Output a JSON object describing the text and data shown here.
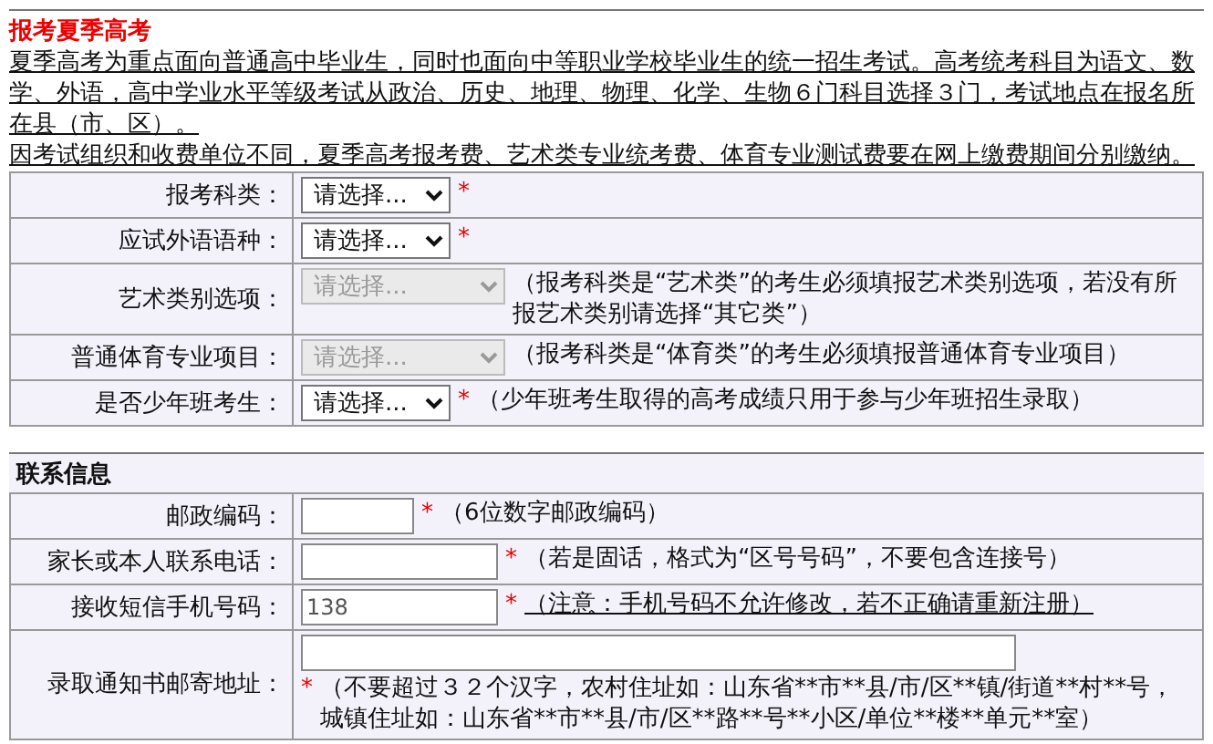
{
  "section_title": "报考夏季高考",
  "intro": [
    {
      "text": "夏季高考为重点面向普通高中毕业生，同时也面向中等职业学校毕业生的统一招生考试。高考统考科目为语文、数学、外语，高中学业水平等级考试从政治、历史、地理、物理、化学、生物６门科目选择３门，考试地点在报名所在县（市、区）。"
    },
    {
      "text": "因考试组织和收费单位不同，夏季高考报考费、艺术类专业统考费、体育专业测试费要在网上缴费期间分别缴纳。"
    }
  ],
  "exam_fields": [
    {
      "label": "报考科类：",
      "kind": "select",
      "value": "请选择...",
      "disabled": false,
      "required_mark": "*"
    },
    {
      "label": "应试外语语种：",
      "kind": "select",
      "value": "请选择...",
      "disabled": false,
      "required_mark": "*"
    },
    {
      "label": "艺术类别选项：",
      "kind": "select",
      "value": "请选择...",
      "disabled": true,
      "note": "（报考科类是“艺术类”的考生必须填报艺术类别选项，若没有所报艺术类别请选择“其它类”）"
    },
    {
      "label": "普通体育专业项目：",
      "kind": "select",
      "value": "请选择...",
      "disabled": true,
      "note": "（报考科类是“体育类”的考生必须填报普通体育专业项目）"
    },
    {
      "label": "是否少年班考生：",
      "kind": "select",
      "value": "请选择...",
      "disabled": false,
      "required_mark": "*",
      "note": "（少年班考生取得的高考成绩只用于参与少年班招生录取）"
    }
  ],
  "contact": {
    "title": "联系信息",
    "fields": [
      {
        "label": "邮政编码：",
        "kind": "short-input",
        "required_mark": "*",
        "note": "（6位数字邮政编码）"
      },
      {
        "label": "家长或本人联系电话：",
        "kind": "input",
        "required_mark": "*",
        "note": "（若是固话，格式为“区号号码”，不要包含连接号）"
      },
      {
        "label": "接收短信手机号码：",
        "kind": "input",
        "value": "138",
        "required_mark": "*",
        "note": "（注意：手机号码不允许修改，若不正确请重新注册）",
        "note_underlined": true
      },
      {
        "label": "录取通知书邮寄地址：",
        "kind": "wide-input",
        "required_mark": "*",
        "note": "（不要超过３２个汉字，农村住址如：山东省**市**县/市/区**镇/街道**村**号，城镇住址如：山东省**市**县/市/区**路**号**小区/单位**楼**单元**室）"
      }
    ]
  }
}
